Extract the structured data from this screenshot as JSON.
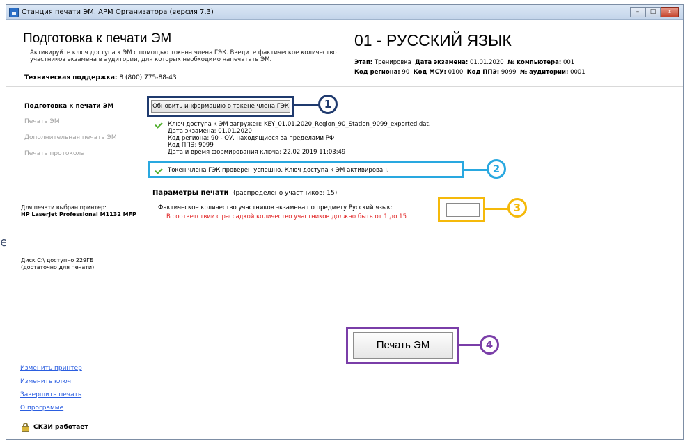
{
  "window": {
    "title": "Станция печати ЭМ. АРМ Организатора (версия 7.3)",
    "buttons": {
      "minimize": "–",
      "maximize": "□",
      "close": "x"
    }
  },
  "header": {
    "title": "Подготовка к печати ЭМ",
    "description_line1": "Активируйте ключ доступа к ЭМ с помощью токена члена ГЭК. Введите фактическое количество",
    "description_line2": "участников экзамена в аудитории, для которых необходимо напечатать ЭМ.",
    "support_label": "Техническая поддержка:",
    "support_phone": "8 (800) 775-88-43",
    "subject": "01 - РУССКИЙ ЯЗЫК",
    "stage_label": "Этап:",
    "stage_value": "Тренировка",
    "exam_date_label": "Дата экзамена:",
    "exam_date_value": "01.01.2020",
    "computer_label": "№ компьютера:",
    "computer_value": "001",
    "region_label": "Код региона:",
    "region_value": "90",
    "msu_label": "Код МСУ:",
    "msu_value": "0100",
    "ppe_label": "Код ППЭ:",
    "ppe_value": "9099",
    "room_label": "№ аудитории:",
    "room_value": "0001"
  },
  "sidebar": {
    "items": [
      {
        "label": "Подготовка к печати ЭМ"
      },
      {
        "label": "Печать ЭМ"
      },
      {
        "label": "Дополнительная печать ЭМ"
      },
      {
        "label": "Печать протокола"
      }
    ],
    "printer_label": "Для печати выбран принтер:",
    "printer_name": "HP LaserJet Professional M1132 MFP",
    "disk_line1": "Диск C:\\ доступно 229ГБ",
    "disk_line2": "(достаточно для печати)",
    "links": [
      {
        "label": "Изменить принтер"
      },
      {
        "label": "Изменить ключ"
      },
      {
        "label": "Завершить печать"
      },
      {
        "label": "О программе"
      }
    ],
    "crypto_status": "СКЗИ работает"
  },
  "main": {
    "refresh_button": "Обновить информацию о токене члена ГЭК",
    "key_loaded": "Ключ доступа к ЭМ загружен: KEY_01.01.2020_Region_90_Station_9099_exported.dat.",
    "key_exam_date": "Дата экзамена: 01.01.2020",
    "key_region": "Код региона: 90 - ОУ, находящиеся за пределами РФ",
    "key_ppe": "Код ППЭ: 9099",
    "key_created": "Дата и время формирования ключа: 22.02.2019 11:03:49",
    "token_ok": "Токен члена ГЭК проверен успешно. Ключ доступа к ЭМ активирован.",
    "params_title": "Параметры печати",
    "params_distributed": "(распределено участников: 15)",
    "count_label": "Фактическое количество участников экзамена по предмету Русский язык:",
    "count_hint": "В соответствии с рассадкой количество участников должно быть от 1 до 15",
    "count_value": "",
    "print_button": "Печать ЭМ"
  },
  "markers": [
    "1",
    "2",
    "3",
    "4"
  ],
  "colors": {
    "marker1": "#1f3a6e",
    "marker2": "#29a8e0",
    "marker3": "#f5b90a",
    "marker4": "#7a3ea8",
    "error_text": "#e02020",
    "link": "#2b5ee0",
    "check": "#4fae2b"
  }
}
